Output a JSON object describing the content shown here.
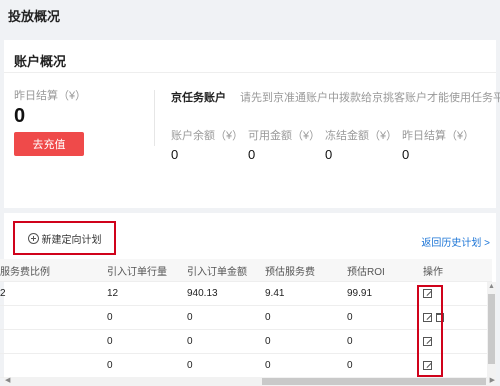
{
  "page_title": "投放概况",
  "account": {
    "header": "账户概况",
    "yesterday_label": "昨日结算（¥）",
    "yesterday_value": "0",
    "recharge_label": "去充值",
    "jd_title": "京任务账户",
    "jd_tip": "请先到京准通账户中拨款给京挑客账户才能使用任务平台",
    "stats": [
      {
        "label": "账户余额（¥）",
        "value": "0"
      },
      {
        "label": "可用金额（¥）",
        "value": "0"
      },
      {
        "label": "冻结金额（¥）",
        "value": "0"
      },
      {
        "label": "昨日结算（¥）",
        "value": "0"
      }
    ]
  },
  "plans": {
    "new_plan_label": "新建定向计划",
    "history_link": "返回历史计划 >",
    "columns": [
      "服务费比例",
      "引入订单行量",
      "引入订单金额",
      "预估服务费",
      "预估ROI",
      "操作"
    ],
    "rows": [
      {
        "rate": "2",
        "orders": "12",
        "amount": "940.13",
        "fee": "9.41",
        "roi": "99.91",
        "has_delete": false
      },
      {
        "rate": "",
        "orders": "0",
        "amount": "0",
        "fee": "0",
        "roi": "0",
        "has_delete": true
      },
      {
        "rate": "",
        "orders": "0",
        "amount": "0",
        "fee": "0",
        "roi": "0",
        "has_delete": false
      },
      {
        "rate": "",
        "orders": "0",
        "amount": "0",
        "fee": "0",
        "roi": "0",
        "has_delete": false
      }
    ]
  },
  "colors": {
    "accent_red": "#ef4a4a",
    "link_blue": "#1b74d6",
    "highlight": "#d0021b"
  },
  "icons": [
    "plus-circle-icon",
    "edit-icon",
    "trash-icon"
  ]
}
